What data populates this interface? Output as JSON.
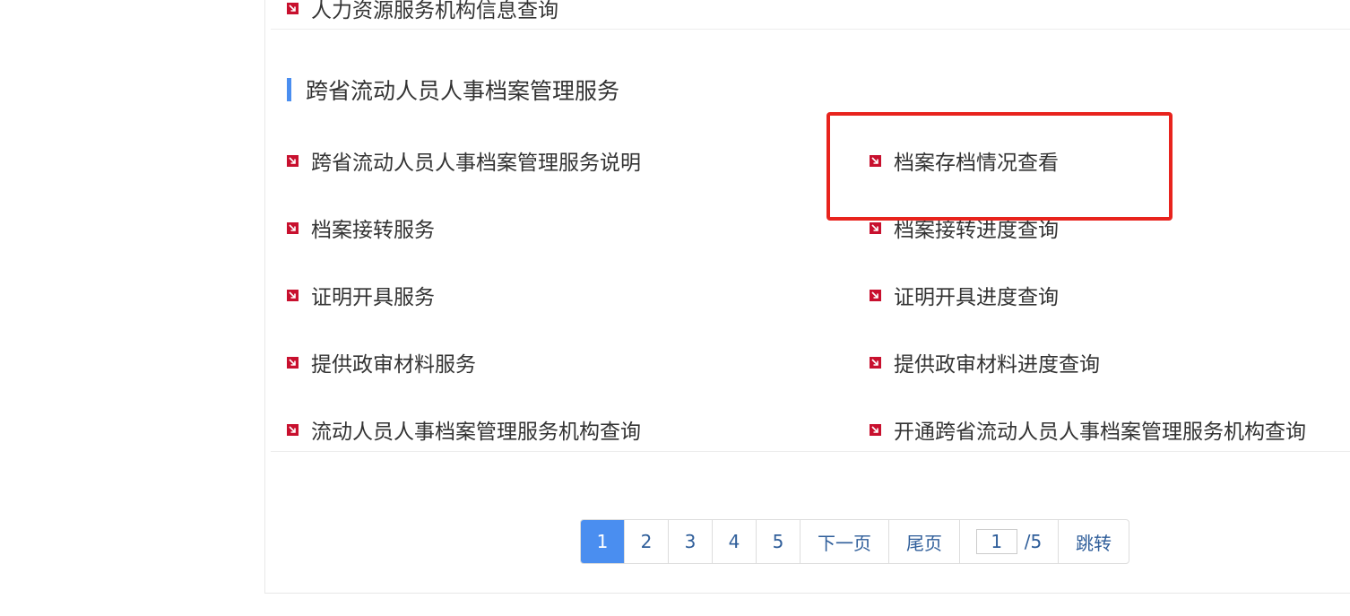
{
  "top_item": {
    "label": "人力资源服务机构信息查询"
  },
  "section": {
    "title": "跨省流动人员人事档案管理服务",
    "items": [
      {
        "label": "跨省流动人员人事档案管理服务说明"
      },
      {
        "label": "档案存档情况查看"
      },
      {
        "label": "档案接转服务"
      },
      {
        "label": "档案接转进度查询"
      },
      {
        "label": "证明开具服务"
      },
      {
        "label": "证明开具进度查询"
      },
      {
        "label": "提供政审材料服务"
      },
      {
        "label": "提供政审材料进度查询"
      },
      {
        "label": "流动人员人事档案管理服务机构查询"
      },
      {
        "label": "开通跨省流动人员人事档案管理服务机构查询"
      }
    ]
  },
  "pagination": {
    "pages": [
      "1",
      "2",
      "3",
      "4",
      "5"
    ],
    "current": "1",
    "next_label": "下一页",
    "last_label": "尾页",
    "jump_value": "1",
    "total_label": "/5",
    "go_label": "跳转"
  },
  "colors": {
    "accent": "#4a8ef0",
    "bullet": "#c8102e",
    "highlight": "#e8231d",
    "link": "#2f5e9a"
  }
}
